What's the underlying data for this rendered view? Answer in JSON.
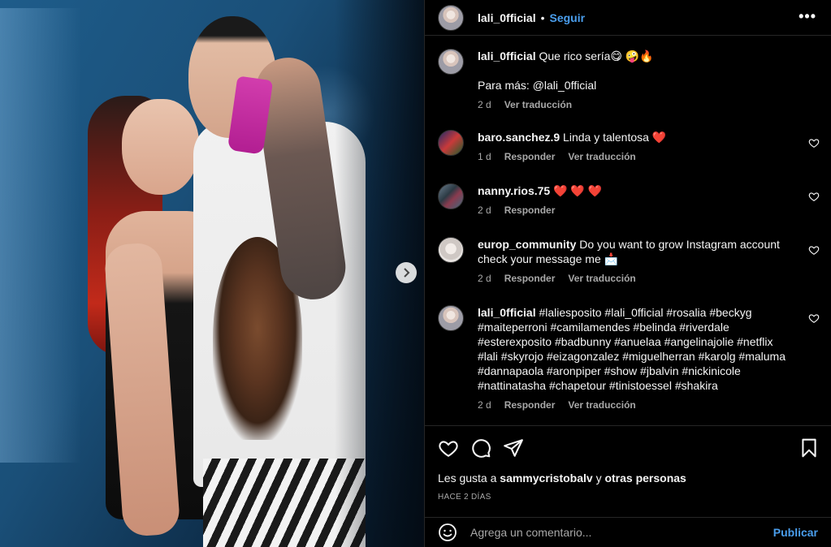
{
  "post": {
    "username": "lali_0fficial",
    "follow_label": "Seguir",
    "separator": "•",
    "more_icon": "more-horizontal-icon",
    "more_label": "•••"
  },
  "caption": {
    "username": "lali_0fficial",
    "text": "Que rico sería😋 🤪🔥",
    "text2": "Para más: @lali_0fficial",
    "time": "2 d",
    "translate": "Ver traducción"
  },
  "comments": [
    {
      "username": "baro.sanchez.9",
      "text": "Linda y talentosa ❤️",
      "time": "1 d",
      "reply": "Responder",
      "translate": "Ver traducción"
    },
    {
      "username": "nanny.rios.75",
      "text": "❤️ ❤️ ❤️",
      "time": "2 d",
      "reply": "Responder",
      "translate": ""
    },
    {
      "username": "europ_community",
      "text": "Do you want to grow Instagram account check your message me 📩",
      "time": "2 d",
      "reply": "Responder",
      "translate": "Ver traducción"
    },
    {
      "username": "lali_0fficial",
      "text": "#laliesposito #lali_0fficial #rosalia #beckyg #maiteperroni #camilamendes #belinda #riverdale #esterexposito #badbunny #anuelaa #angelinajolie #netflix #lali #skyrojo #eizagonzalez #miguelherran #karolg #maluma #dannapaola #aronpiper #show #jbalvin #nickinicole #nattinatasha #chapetour #tinistoessel #shakira",
      "time": "2 d",
      "reply": "Responder",
      "translate": "Ver traducción"
    }
  ],
  "likes": {
    "prefix": "Les gusta a",
    "user": "sammycristobalv",
    "middle": "y",
    "others": "otras personas"
  },
  "timeago": "HACE 2 DÍAS",
  "add_comment": {
    "placeholder": "Agrega un comentario...",
    "publish": "Publicar"
  },
  "colors": {
    "accent": "#4a9eed",
    "background": "#000000",
    "muted": "#a8a8a8",
    "heart": "#ed2a2a"
  }
}
